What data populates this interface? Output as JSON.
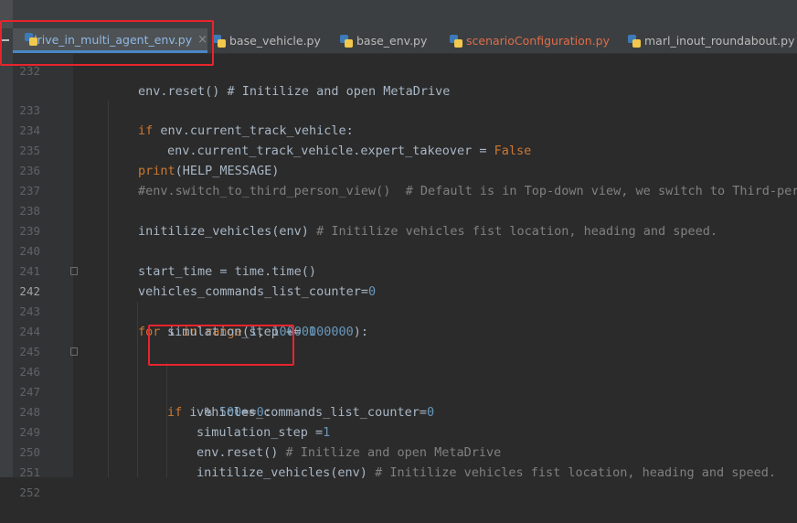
{
  "tabs": [
    {
      "label": "drive_in_multi_agent_env.py",
      "active": true,
      "close": "×"
    },
    {
      "label": "base_vehicle.py"
    },
    {
      "label": "base_env.py"
    },
    {
      "label": "scenarioConfiguration.py",
      "color": "#e06c4a"
    },
    {
      "label": "marl_inout_roundabout.py"
    }
  ],
  "editor": {
    "lines": [
      {
        "n": "232",
        "text": "env.reset() # Initilize and open MetaDrive"
      },
      {
        "n": "233",
        "text": ""
      },
      {
        "n": "234",
        "text": "env.current_track_vehicle.expert_takeover = False"
      },
      {
        "n": "235",
        "text": "print(HELP_MESSAGE)"
      },
      {
        "n": "236",
        "text": "#env.switch_to_third_person_view()  # Default is in Top-down view, we switch to Third-pers"
      },
      {
        "n": "237",
        "text": ""
      },
      {
        "n": "238",
        "text": "initilize_vehicles(env) # Initilize vehicles fist location, heading and speed."
      },
      {
        "n": "239",
        "text": ""
      },
      {
        "n": "240",
        "text": "start_time = time.time()"
      },
      {
        "n": "241",
        "text": "vehicles_commands_list_counter=0"
      },
      {
        "n": "242",
        "text": "for i in range(1, 10000000000):"
      },
      {
        "n": "243",
        "text": "simulation_step += 1"
      },
      {
        "n": "244",
        "text": ""
      },
      {
        "n": "245",
        "text": ""
      },
      {
        "n": "246",
        "text": "if i % 500==0:"
      },
      {
        "n": "247",
        "text": "vehicles_commands_list_counter=0"
      },
      {
        "n": "248",
        "text": "simulation_step =1"
      },
      {
        "n": "249",
        "text": "env.reset() # Initlize and open MetaDrive"
      },
      {
        "n": "250",
        "text": "initilize_vehicles(env) # Initilize vehicles fist location, heading and speed."
      },
      {
        "n": "251",
        "text": ""
      },
      {
        "n": "252",
        "text": ""
      }
    ],
    "line_233": "if env.current_track_vehicle:",
    "current_line": "242"
  },
  "colors": {
    "keyword": "#cc7832",
    "number": "#6897bb",
    "comment": "#808080",
    "highlight": "#e8242c"
  }
}
